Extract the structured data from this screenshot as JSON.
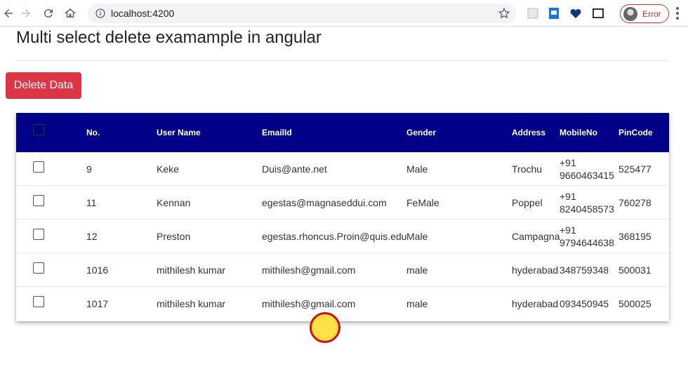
{
  "browser": {
    "url": "localhost:4200",
    "profile_status": "Error",
    "icons": [
      "back-icon",
      "forward-icon",
      "reload-icon",
      "home-icon",
      "info-icon",
      "star-icon",
      "extension-icon",
      "cast-icon",
      "menu-icon"
    ]
  },
  "page": {
    "title": "Multi select delete examample in angular",
    "delete_button": "Delete Data"
  },
  "table": {
    "headers": {
      "no": "No.",
      "username": "User Name",
      "email": "EmailId",
      "gender": "Gender",
      "address": "Address",
      "mobile": "MobileNo",
      "pincode": "PinCode"
    },
    "header_bg": "#000088",
    "rows": [
      {
        "no": "9",
        "username": "Keke",
        "email": "Duis@ante.net",
        "gender": "Male",
        "address": "Trochu",
        "mobile": "+91 9660463415",
        "pincode": "525477"
      },
      {
        "no": "11",
        "username": "Kennan",
        "email": "egestas@magnaseddui.com",
        "gender": "FeMale",
        "address": "Poppel",
        "mobile": "+91 8240458573",
        "pincode": "760278"
      },
      {
        "no": "12",
        "username": "Preston",
        "email": "egestas.rhoncus.Proin@quis.edu",
        "gender": "Male",
        "address": "Campagna",
        "mobile": "+91 9794644638",
        "pincode": "368195"
      },
      {
        "no": "1016",
        "username": "mithilesh kumar",
        "email": "mithilesh@gmail.com",
        "gender": "male",
        "address": "hyderabad",
        "mobile": "348759348",
        "pincode": "500031"
      },
      {
        "no": "1017",
        "username": "mithilesh kumar",
        "email": "mithilesh@gmail.com",
        "gender": "male",
        "address": "hyderabad",
        "mobile": "093450945",
        "pincode": "500025"
      }
    ]
  },
  "colors": {
    "delete_button": "#dc3545",
    "header": "#000088",
    "error": "#d93025"
  }
}
